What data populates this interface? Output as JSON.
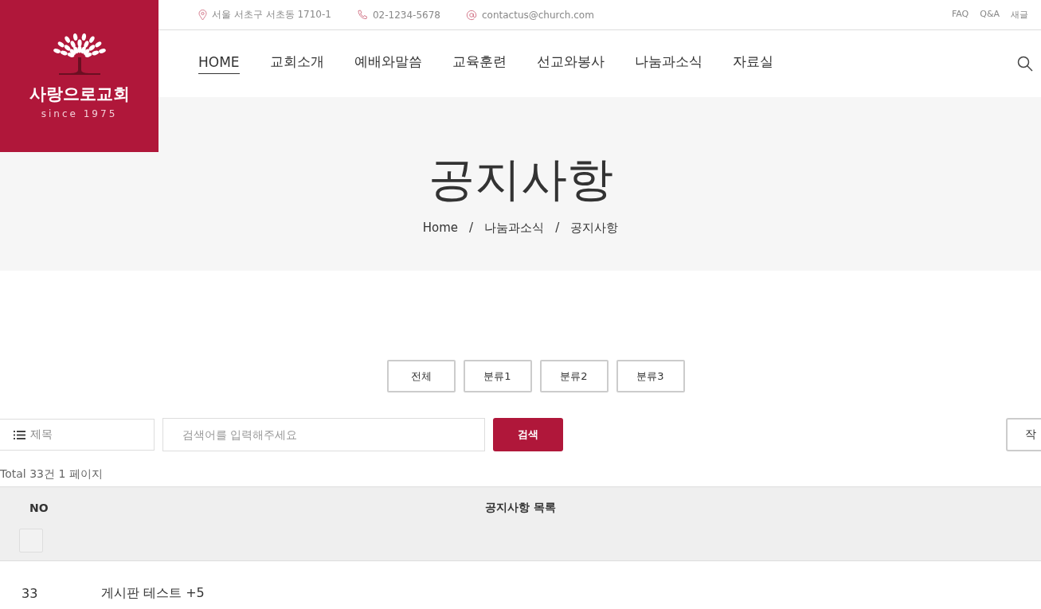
{
  "logo": {
    "name": "사랑으로교회",
    "since": "since 1975"
  },
  "topbar": {
    "contacts": [
      {
        "kind": "address",
        "text": "서울 서초구 서초동 1710-1"
      },
      {
        "kind": "phone",
        "text": "02-1234-5678"
      },
      {
        "kind": "email",
        "text": "contactus@church.com"
      }
    ],
    "links": [
      "FAQ",
      "Q&A",
      "새글"
    ]
  },
  "nav": [
    {
      "label": "HOME",
      "selected": true
    },
    {
      "label": "교회소개",
      "selected": false
    },
    {
      "label": "예배와말씀",
      "selected": false
    },
    {
      "label": "교육훈련",
      "selected": false
    },
    {
      "label": "선교와봉사",
      "selected": false
    },
    {
      "label": "나눔과소식",
      "selected": false
    },
    {
      "label": "자료실",
      "selected": false
    }
  ],
  "hero": {
    "title": "공지사항",
    "breadcrumb": [
      "Home",
      "나눔과소식",
      "공지사항"
    ],
    "separator": "/"
  },
  "categories": [
    {
      "label": "전체",
      "selected": false
    },
    {
      "label": "분류1",
      "selected": false
    },
    {
      "label": "분류2",
      "selected": false
    },
    {
      "label": "분류3",
      "selected": false
    }
  ],
  "search": {
    "field_select": "제목",
    "placeholder": "검색어를 입력해주세요",
    "button": "검색",
    "write_button": "작"
  },
  "total": "Total 33건 1 페이지",
  "table": {
    "columns": [
      "NO",
      "공지사항 목록"
    ],
    "select_all_checked": false,
    "rows": [
      {
        "no": "33",
        "title": "게시판 테스트 +5"
      }
    ]
  }
}
